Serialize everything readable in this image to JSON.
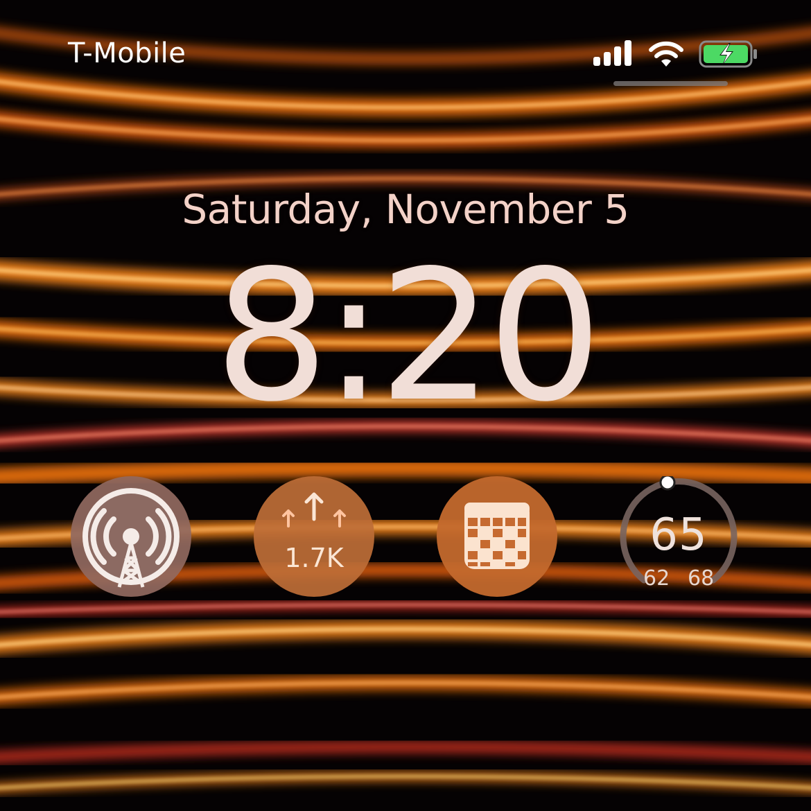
{
  "status_bar": {
    "carrier": "T-Mobile",
    "signal_bars": 4,
    "wifi": "wifi-icon",
    "battery": "charging-battery-icon",
    "battery_color": "#4cd964"
  },
  "lock_screen": {
    "date": "Saturday, November 5",
    "time": "8:20"
  },
  "widgets": {
    "overcast": {
      "icon": "podcast-antenna-icon"
    },
    "upvotes": {
      "icon": "arrows-up-icon",
      "count": "1.7K"
    },
    "crossword": {
      "icon": "crossword-calendar-icon"
    },
    "weather": {
      "current": "65",
      "low": "62",
      "high": "68",
      "level": 0.5
    }
  },
  "colors": {
    "accent_orange": "#ff8a1e",
    "background": "#050203"
  }
}
